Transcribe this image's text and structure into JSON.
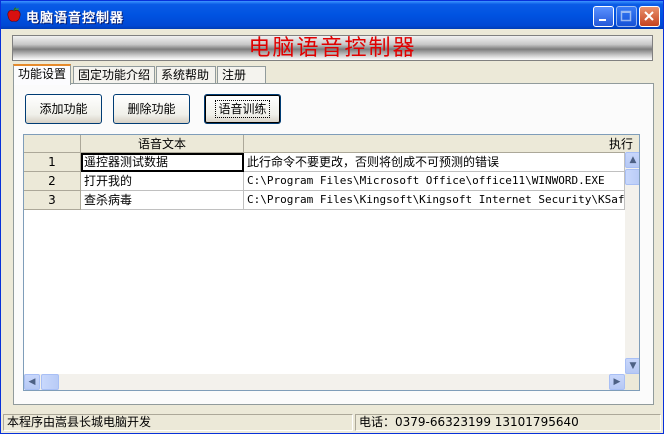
{
  "window": {
    "title": "电脑语音控制器"
  },
  "banner": {
    "text": "电脑语音控制器"
  },
  "tabs": [
    {
      "label": "功能设置",
      "active": true
    },
    {
      "label": "固定功能介绍",
      "active": false
    },
    {
      "label": "系统帮助",
      "active": false
    },
    {
      "label": "注册",
      "active": false
    }
  ],
  "toolbar": {
    "add_label": "添加功能",
    "delete_label": "删除功能",
    "train_label": "语音训练"
  },
  "grid": {
    "columns": [
      "语音文本",
      "执行"
    ],
    "rows": [
      {
        "num": "1",
        "text": "遥控器测试数据",
        "command": "此行命令不要更改，否则将创成不可预测的错误"
      },
      {
        "num": "2",
        "text": "打开我的",
        "command": "C:\\Program Files\\Microsoft Office\\office11\\WINWORD.EXE"
      },
      {
        "num": "3",
        "text": "查杀病毒",
        "command": "C:\\Program Files\\Kingsoft\\Kingsoft Internet Security\\KSafe"
      }
    ]
  },
  "status": {
    "left": "本程序由嵩县长城电脑开发",
    "right": "电话：0379-66323199   13101795640"
  },
  "colors": {
    "banner_text": "#e00000",
    "titlebar": "#0053e1"
  }
}
